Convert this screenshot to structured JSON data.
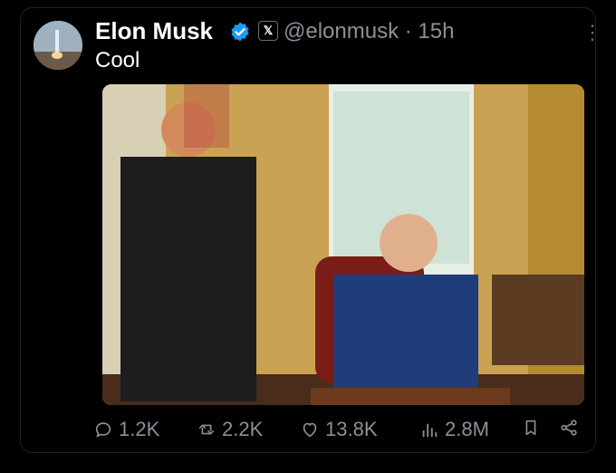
{
  "post": {
    "author_name": "Elon Musk",
    "handle": "@elonmusk",
    "time": "15h",
    "text": "Cool",
    "media_caption": ""
  },
  "actions": {
    "replies": "1.2K",
    "reposts": "2.2K",
    "likes": "13.8K",
    "views": "2.8M"
  }
}
